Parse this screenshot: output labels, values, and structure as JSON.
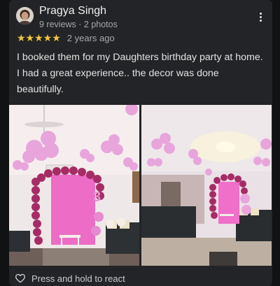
{
  "review": {
    "author": "Pragya Singh",
    "meta": "9 reviews · 2 photos",
    "rating": 5,
    "stars": "★★★★★",
    "time_ago": "2 years ago",
    "text": "I booked them for my Daughters birthday party at home. I had a great experience.. the decor was done beautifully."
  },
  "footer": {
    "react_label": "Press and hold to react"
  },
  "colors": {
    "star": "#f4c63b",
    "card_bg": "#232427",
    "balloon_pink": "#e59ad4",
    "backdrop_pink": "#f06bc7"
  },
  "icons": [
    "more-options-icon",
    "heart-icon"
  ]
}
